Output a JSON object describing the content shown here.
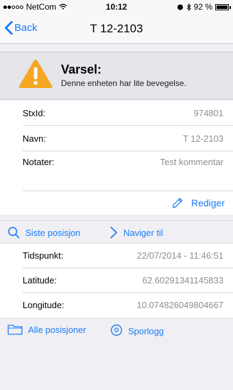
{
  "status_bar": {
    "carrier": "NetCom",
    "time": "10:12",
    "battery": "92 %",
    "signal_bars_filled": 2,
    "signal_bars_total": 5
  },
  "nav": {
    "back_label": "Back",
    "title": "T 12-2103"
  },
  "warning": {
    "title": "Varsel:",
    "message": "Denne enheten har lite bevegelse.",
    "icon": "warning-triangle-icon",
    "icon_color": "#f5a623"
  },
  "fields": [
    {
      "label": "StxId:",
      "value": "974801"
    },
    {
      "label": "Navn:",
      "value": "T 12-2103"
    }
  ],
  "notes": {
    "label": "Notater:",
    "value": "Test kommentar"
  },
  "edit": {
    "label": "Rediger",
    "icon": "pencil-icon"
  },
  "actions_primary": [
    {
      "label": "Siste posisjon",
      "icon": "search-icon"
    },
    {
      "label": "Naviger til",
      "icon": "chevron-right-icon"
    }
  ],
  "info": [
    {
      "label": "Tidspunkt:",
      "value": "22/07/2014 - 11:46:51"
    },
    {
      "label": "Latitude:",
      "value": "62.60291341145833"
    },
    {
      "label": "Longitude:",
      "value": "10.074826049804667"
    }
  ],
  "actions_secondary": [
    {
      "label": "Alle posisjoner",
      "icon": "folder-icon"
    },
    {
      "label": "Sporlogg",
      "icon": "location-pin-icon"
    }
  ],
  "colors": {
    "accent": "#1a7cf9",
    "background": "#efeff4",
    "secondary_text": "#8e8e93"
  }
}
